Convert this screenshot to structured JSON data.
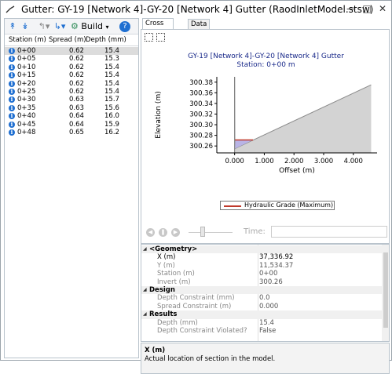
{
  "window": {
    "title": "Gutter: GY-19 [Network 4]-GY-20 [Network 4] Gutter (RaodInletModel.stsw)"
  },
  "toolbar": {
    "build_label": "Build"
  },
  "table": {
    "columns": [
      "Station (m)",
      "Spread (m)",
      "Depth (mm)"
    ],
    "rows": [
      {
        "station": "0+00",
        "spread": "0.62",
        "depth": "15.4"
      },
      {
        "station": "0+05",
        "spread": "0.62",
        "depth": "15.3"
      },
      {
        "station": "0+10",
        "spread": "0.62",
        "depth": "15.4"
      },
      {
        "station": "0+15",
        "spread": "0.62",
        "depth": "15.4"
      },
      {
        "station": "0+20",
        "spread": "0.62",
        "depth": "15.4"
      },
      {
        "station": "0+25",
        "spread": "0.62",
        "depth": "15.4"
      },
      {
        "station": "0+30",
        "spread": "0.63",
        "depth": "15.7"
      },
      {
        "station": "0+35",
        "spread": "0.63",
        "depth": "15.6"
      },
      {
        "station": "0+40",
        "spread": "0.64",
        "depth": "16.0"
      },
      {
        "station": "0+45",
        "spread": "0.64",
        "depth": "15.9"
      },
      {
        "station": "0+48",
        "spread": "0.65",
        "depth": "16.2"
      }
    ]
  },
  "tabs": [
    "Cross Section",
    "Data"
  ],
  "chart_title": {
    "line1": "GY-19 [Network 4]-GY-20 [Network 4] Gutter",
    "line2": "Station: 0+00 m"
  },
  "chart_data": {
    "type": "area",
    "title": "GY-19 [Network 4]-GY-20 [Network 4] Gutter",
    "subtitle": "Station: 0+00 m",
    "xlabel": "Offset (m)",
    "ylabel": "Elevation (m)",
    "xlim": [
      -0.6,
      4.8
    ],
    "ylim": [
      300.247,
      300.39
    ],
    "xticks": [
      "0.000",
      "1.000",
      "2.000",
      "3.000",
      "4.000"
    ],
    "xtick_values": [
      0,
      1,
      2,
      3,
      4
    ],
    "yticks": [
      "300.26",
      "300.28",
      "300.30",
      "300.32",
      "300.34",
      "300.36",
      "300.38"
    ],
    "ytick_values": [
      300.26,
      300.28,
      300.3,
      300.32,
      300.34,
      300.36,
      300.38
    ],
    "ground": {
      "x": [
        0,
        0,
        0.008,
        0.62,
        4.6,
        4.6
      ],
      "y": [
        300.247,
        300.39,
        300.255,
        300.271,
        300.375,
        300.247
      ]
    },
    "curb_x": 0,
    "hgl": {
      "x": [
        0,
        0.62
      ],
      "y": 300.2714
    },
    "legend": [
      "Hydraulic Grade (Maximum)"
    ],
    "colors": {
      "ground": "#d3d3d3",
      "ground_edge": "#8a8a8a",
      "water": "#b9b4e6",
      "hgl": "#c0392b",
      "axis": "#000000"
    }
  },
  "player": {
    "time_label": "Time:"
  },
  "properties": [
    {
      "type": "cat",
      "key": "<Geometry>"
    },
    {
      "type": "prop",
      "key": "X (m)",
      "value": "37,336.92"
    },
    {
      "type": "prop",
      "key": "Y (m)",
      "value": "11,534.37"
    },
    {
      "type": "prop",
      "key": "Station (m)",
      "value": "0+00"
    },
    {
      "type": "prop",
      "key": "Invert (m)",
      "value": "300.26"
    },
    {
      "type": "cat",
      "key": "Design"
    },
    {
      "type": "prop",
      "key": "Depth Constraint (mm)",
      "value": "0.0"
    },
    {
      "type": "prop",
      "key": "Spread Constraint (m)",
      "value": "0.000"
    },
    {
      "type": "cat",
      "key": "Results"
    },
    {
      "type": "prop",
      "key": "Depth (mm)",
      "value": "15.4"
    },
    {
      "type": "prop",
      "key": "Depth Constraint Violated?",
      "value": "False"
    }
  ],
  "description": {
    "title": "X (m)",
    "text": "Actual location of section in the model."
  }
}
